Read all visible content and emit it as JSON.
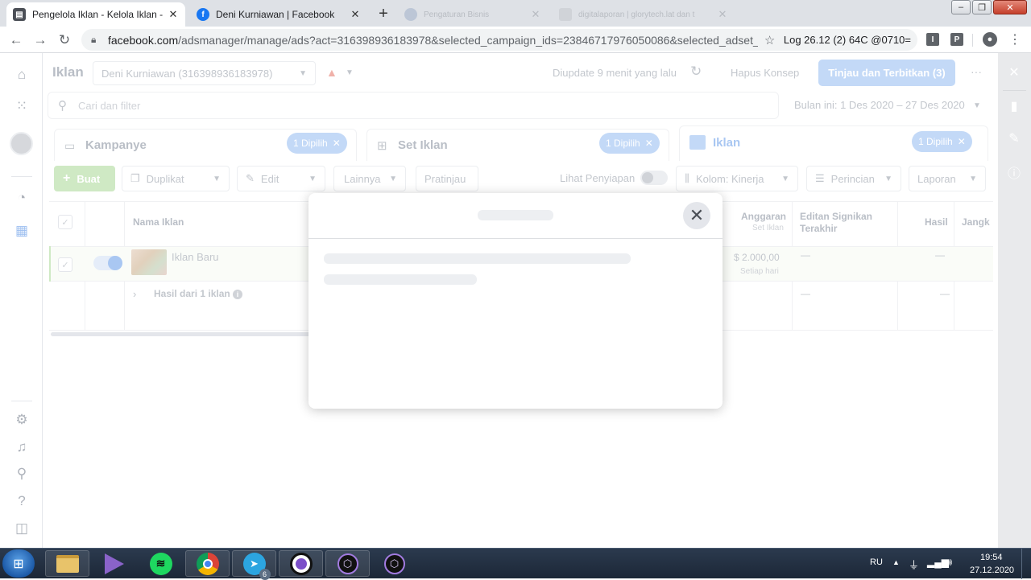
{
  "browser": {
    "tabs": [
      {
        "title": "Pengelola Iklan - Kelola Iklan - Ik",
        "icon": "ads-manager-icon",
        "active": true
      },
      {
        "title": "Deni Kurniawan | Facebook",
        "icon": "facebook-icon",
        "active": false
      },
      {
        "title": "Pengaturan Bisnis",
        "icon": "facebook-icon",
        "active": false
      },
      {
        "title": "digitalaporan | glorytech.lat dan t",
        "icon": "google-icon",
        "active": false
      }
    ],
    "new_tab_label": "+",
    "close_glyph": "✕",
    "url_host": "facebook.com",
    "url_path": "/adsmanager/manage/ads?act=316398936183978&selected_campaign_ids=23846717976050086&selected_adset_ids=238...",
    "extension_text": "Log 26.12 (2) 64C @0710=",
    "ext_btn_1": "I",
    "ext_btn_2": "P"
  },
  "header": {
    "title": "Iklan",
    "account": "Deni Kurniawan (316398936183978)",
    "updated": "Diupdate 9 menit yang lalu",
    "discard": "Hapus Konsep",
    "publish": "Tinjau dan Terbitkan (3)",
    "more": "···"
  },
  "search": {
    "placeholder": "Cari dan filter",
    "date_range": "Bulan ini: 1 Des 2020 – 27 Des 2020"
  },
  "levels": [
    {
      "label": "Kampanye",
      "pill": "1 Dipilih"
    },
    {
      "label": "Set Iklan",
      "pill": "1 Dipilih"
    },
    {
      "label": "Iklan",
      "pill": "1 Dipilih"
    }
  ],
  "toolbar": {
    "create": "Buat",
    "duplicate": "Duplikat",
    "edit": "Edit",
    "more": "Lainnya",
    "preview": "Pratinjau",
    "view_setup": "Lihat Penyiapan",
    "columns": "Kolom: Kinerja",
    "breakdown": "Perincian",
    "reports": "Laporan"
  },
  "table": {
    "headers": {
      "name": "Nama Iklan",
      "budget": "Anggaran",
      "budget_sub": "Set Iklan",
      "edit": "Editan Signikan Terakhir",
      "results": "Hasil",
      "reach": "Jangk"
    },
    "rows": [
      {
        "name": "Iklan Baru",
        "budget": "$ 2.000,00",
        "budget_sub": "Setiap hari",
        "edit": "—",
        "results": "—"
      }
    ],
    "summary": {
      "label": "Hasil dari 1 iklan",
      "edit": "—",
      "results": "—"
    }
  },
  "modal": {
    "close_glyph": "✕",
    "loading": true
  },
  "taskbar": {
    "lang": "RU",
    "time": "19:54",
    "date": "27.12.2020",
    "telegram_badge": "6"
  },
  "colors": {
    "accent": "#1877f2",
    "pill": "#c3d9f7",
    "create": "#cfe9c4"
  }
}
